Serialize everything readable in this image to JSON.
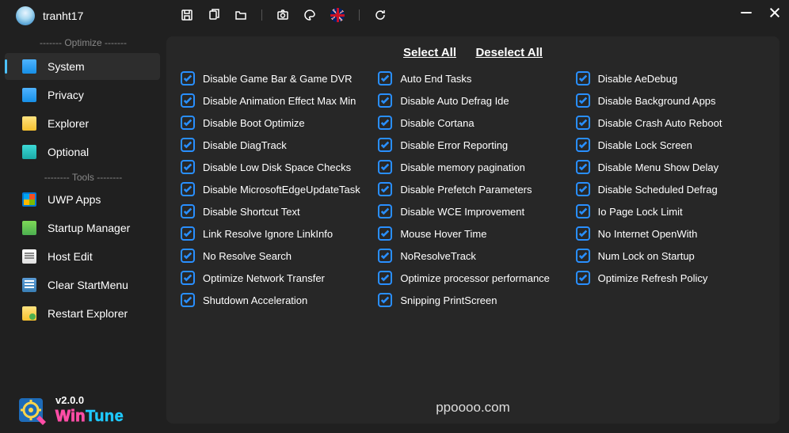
{
  "user": {
    "name": "tranht17"
  },
  "headers": {
    "optimize": "------- Optimize -------",
    "tools": "-------- Tools --------"
  },
  "sidebar": {
    "items": [
      {
        "label": "System"
      },
      {
        "label": "Privacy"
      },
      {
        "label": "Explorer"
      },
      {
        "label": "Optional"
      },
      {
        "label": "UWP Apps"
      },
      {
        "label": "Startup Manager"
      },
      {
        "label": "Host Edit"
      },
      {
        "label": "Clear StartMenu"
      },
      {
        "label": "Restart Explorer"
      }
    ]
  },
  "actions": {
    "selectAll": "Select All",
    "deselectAll": "Deselect All"
  },
  "options": {
    "col1": [
      "Disable Game Bar & Game DVR",
      "Disable Animation Effect Max Min",
      "Disable Boot Optimize",
      "Disable DiagTrack",
      "Disable Low Disk Space Checks",
      "Disable MicrosoftEdgeUpdateTask",
      "Disable Shortcut Text",
      "Link Resolve Ignore LinkInfo",
      "No Resolve Search",
      "Optimize Network Transfer",
      "Shutdown Acceleration"
    ],
    "col2": [
      "Auto End Tasks",
      "Disable Auto Defrag Ide",
      "Disable Cortana",
      "Disable Error Reporting",
      "Disable memory pagination",
      "Disable Prefetch Parameters",
      "Disable WCE Improvement",
      "Mouse Hover Time",
      "NoResolveTrack",
      "Optimize processor performance",
      "Snipping PrintScreen"
    ],
    "col3": [
      "Disable AeDebug",
      "Disable Background Apps",
      "Disable Crash Auto Reboot",
      "Disable Lock Screen",
      "Disable Menu Show Delay",
      "Disable Scheduled Defrag",
      "Io Page Lock Limit",
      "No Internet OpenWith",
      "Num Lock on Startup",
      "Optimize Refresh Policy"
    ]
  },
  "footer": {
    "version": "v2.0.0",
    "logo1": "Win",
    "logo2": "Tune",
    "watermark": "ppoooo.com"
  }
}
